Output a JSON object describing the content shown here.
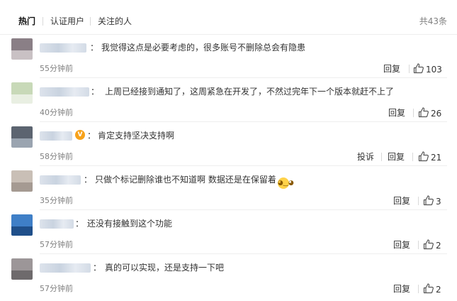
{
  "tabs": [
    {
      "label": "热门"
    },
    {
      "label": "认证用户"
    },
    {
      "label": "关注的人"
    }
  ],
  "total": "共43条",
  "actions": {
    "reply": "回复",
    "report": "投诉"
  },
  "comments": [
    {
      "colon": "：",
      "text": "我觉得这点是必要考虑的，很多账号不删除总会有隐患",
      "time": "55分钟前",
      "likes": "103",
      "avatar_colors": [
        "#8a7f86",
        "#c9c1c4"
      ]
    },
    {
      "colon": "：",
      "text": "上周已经接到通知了，这周紧急在开发了，不然过完年下一个版本就赶不上了",
      "time": "40分钟前",
      "likes": "26",
      "avatar_colors": [
        "#c8d9b8",
        "#e9efe2"
      ]
    },
    {
      "colon": "：",
      "text": "肯定支持坚决支持啊",
      "time": "58分钟前",
      "likes": "21",
      "verified": true,
      "avatar_colors": [
        "#5c6470",
        "#9aa4b0"
      ]
    },
    {
      "colon": "：",
      "text": "只做个标记删除谁也不知道啊 数据还是在保留着",
      "time": "35分钟前",
      "likes": "3",
      "emoji": "face-with-tears-of-joy",
      "avatar_colors": [
        "#c9bfb6",
        "#a59a92"
      ]
    },
    {
      "colon": "：",
      "text": "还没有接触到这个功能",
      "time": "57分钟前",
      "likes": "2",
      "avatar_colors": [
        "#3f7fc7",
        "#1f4f8a"
      ]
    },
    {
      "colon": "：",
      "text": "真的可以实现，还是支持一下吧",
      "time": "57分钟前",
      "likes": "2",
      "avatar_colors": [
        "#9c9698",
        "#6e6a6c"
      ]
    }
  ],
  "colors": {
    "text": "#333333",
    "muted": "#808080",
    "verified_badge": "#f7a21b"
  }
}
